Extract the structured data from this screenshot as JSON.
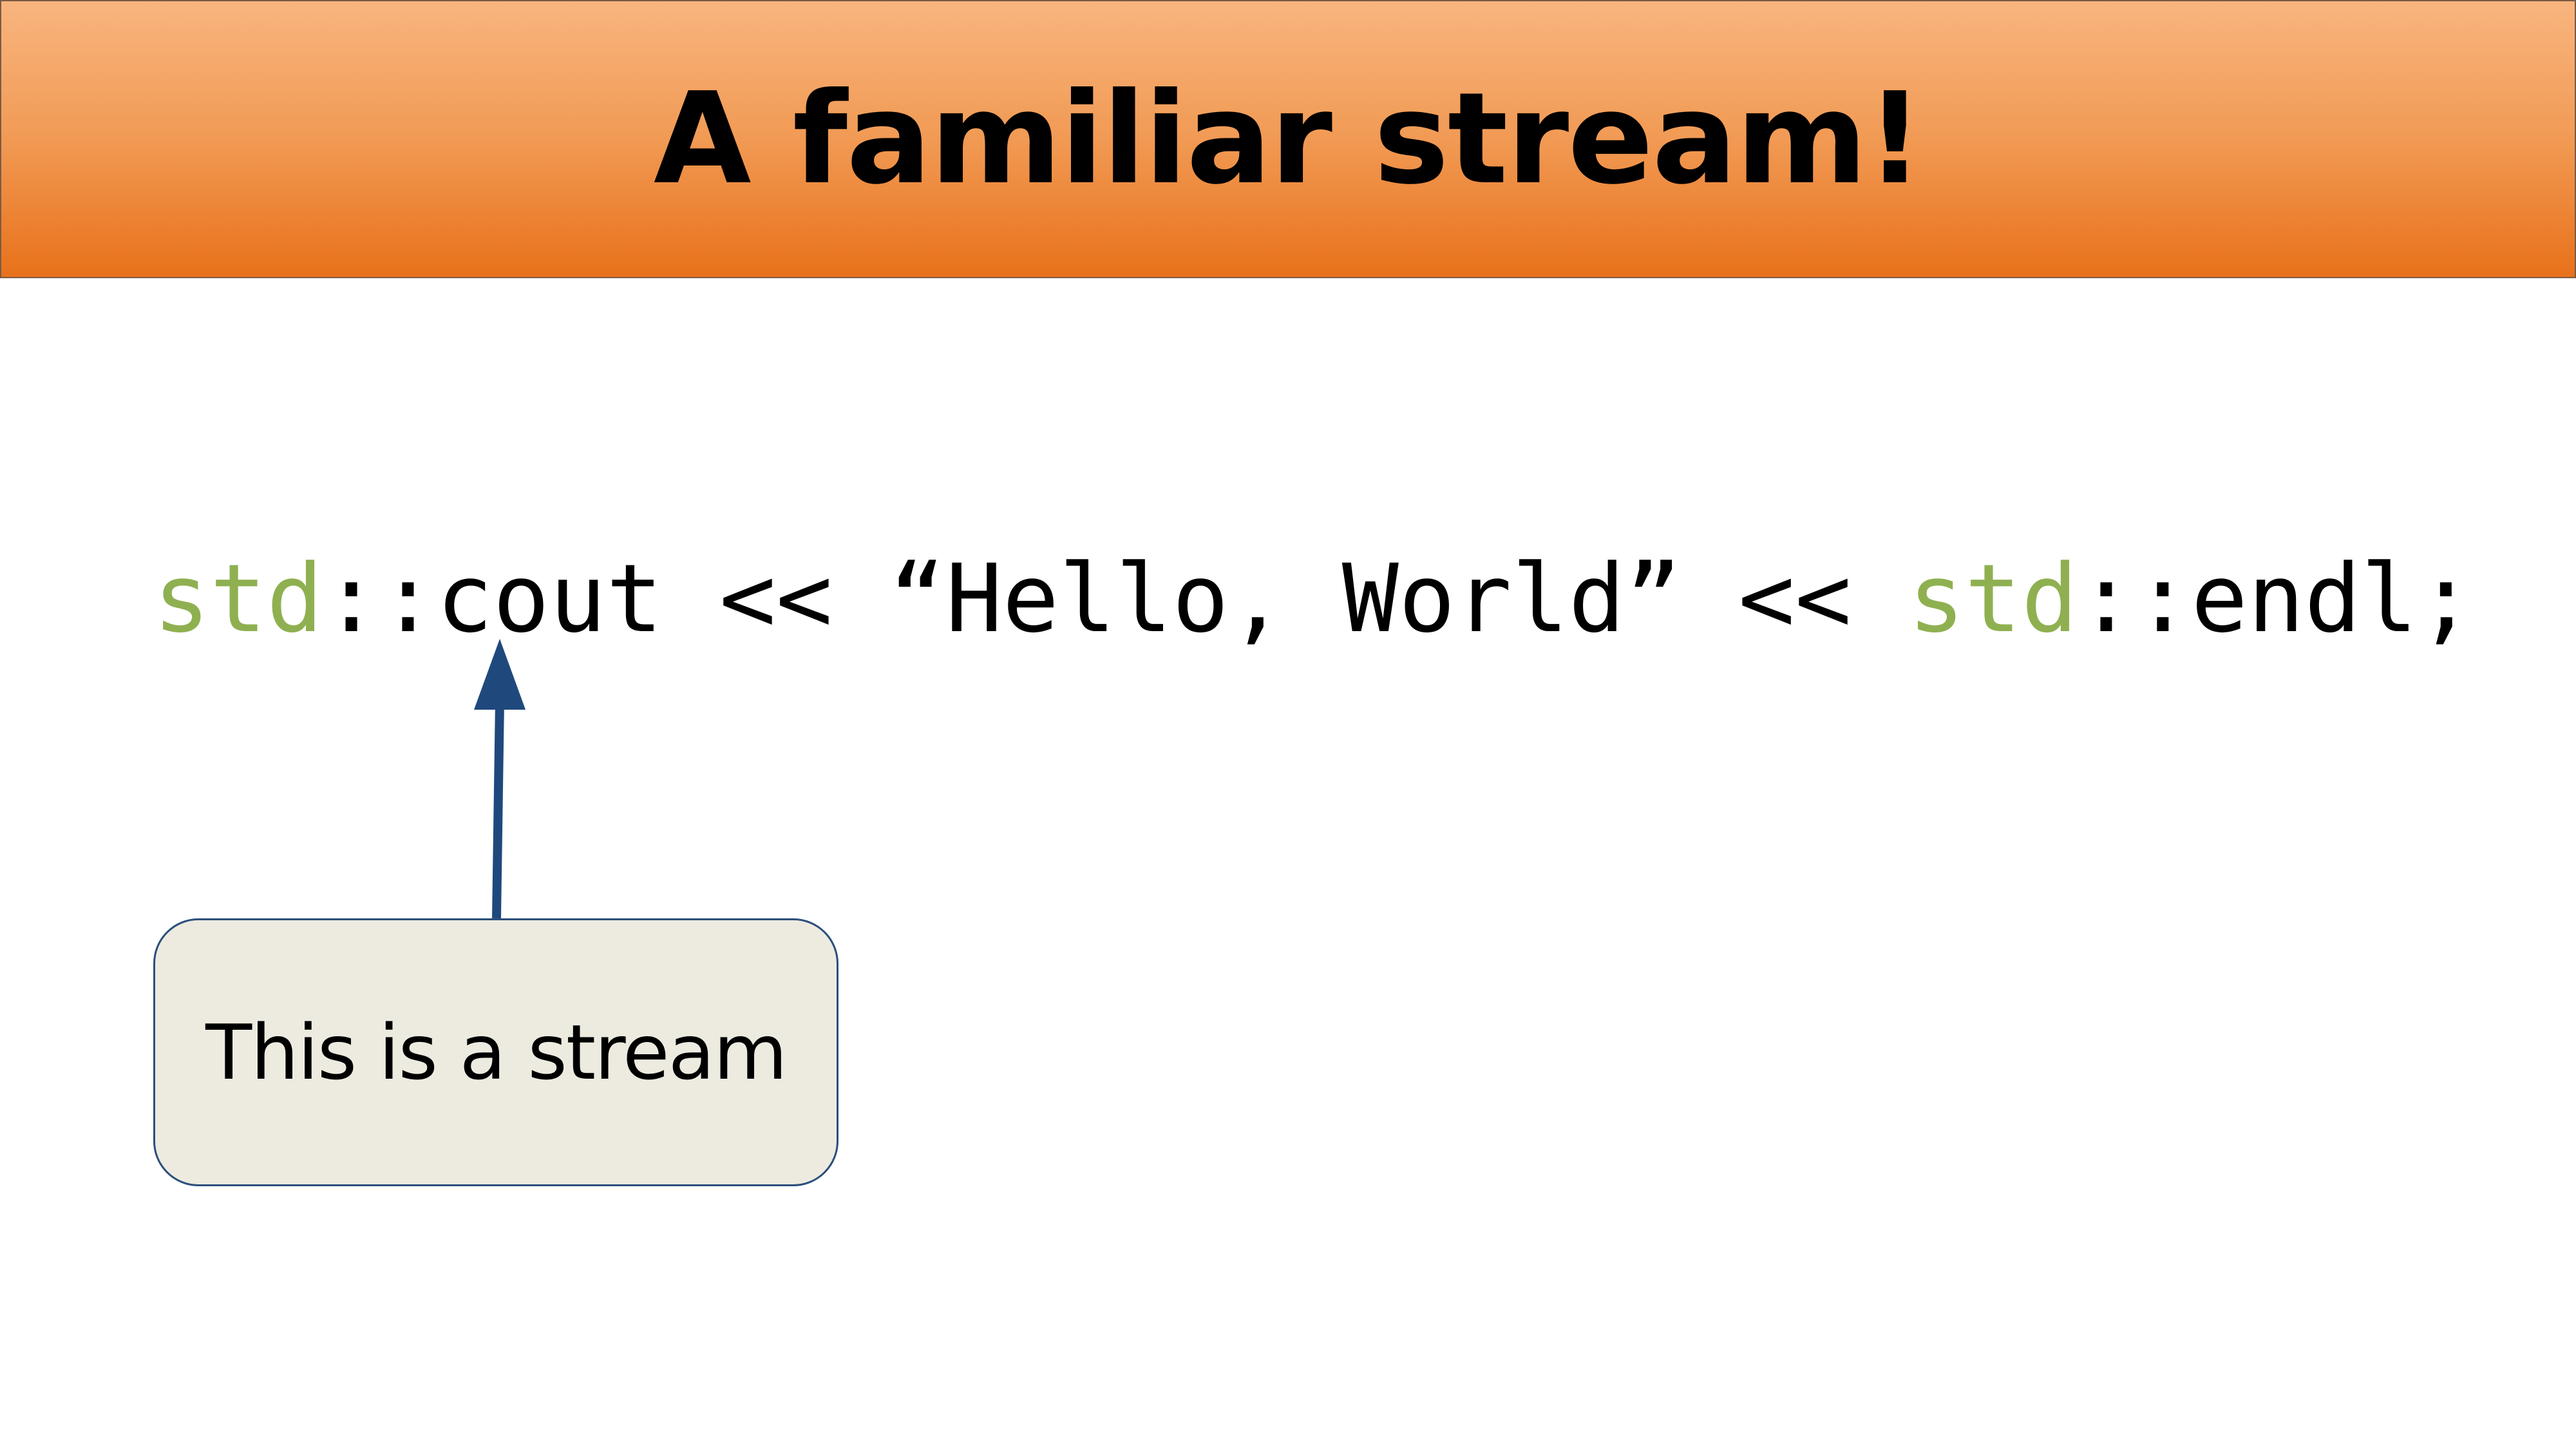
{
  "slide": {
    "title": "A familiar stream!",
    "code": {
      "segments": [
        {
          "text": "std",
          "role": "namespace"
        },
        {
          "text": "::cout << “Hello, World” << ",
          "role": "plain"
        },
        {
          "text": "std",
          "role": "namespace"
        },
        {
          "text": "::endl;",
          "role": "plain"
        }
      ]
    },
    "callout": {
      "text": "This is a stream"
    }
  },
  "colors": {
    "title_gradient_top": "#f8b57f",
    "title_gradient_bottom": "#e8711a",
    "namespace": "#8fb051",
    "arrow": "#1f497d",
    "callout_fill": "#edebe0",
    "callout_border": "#2c4f7c"
  }
}
